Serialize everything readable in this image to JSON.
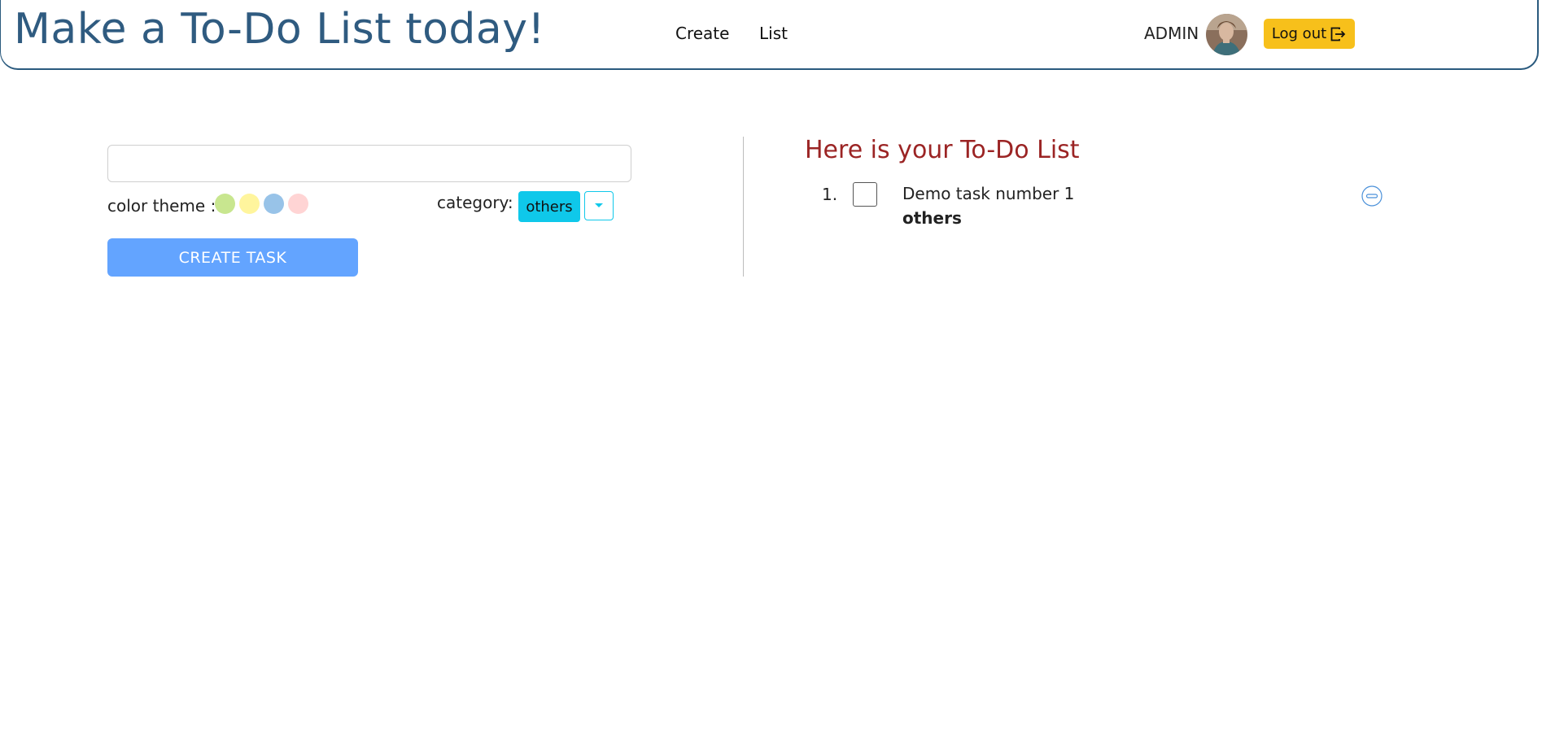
{
  "header": {
    "app_title": "Make a To-Do List today!",
    "nav": [
      {
        "label": "Create"
      },
      {
        "label": "List"
      }
    ],
    "user_name": "ADMIN",
    "logout_label": "Log out"
  },
  "create_form": {
    "task_input_value": "",
    "task_input_placeholder": "",
    "color_theme_label": "color theme :",
    "color_options": [
      "#c8e68f",
      "#fff59d",
      "#98c3e8",
      "#ffd4d4"
    ],
    "category_label": "category:",
    "category_selected": "others",
    "create_button_label": "CREATE TASK"
  },
  "todo_list": {
    "title": "Here is your To-Do List",
    "items": [
      {
        "number": "1.",
        "text": "Demo task number 1",
        "category": "others",
        "done": false
      }
    ]
  },
  "colors": {
    "brand_blue": "#2f5b80",
    "logout_yellow": "#f7c01b",
    "category_cyan": "#0fc8ea",
    "create_button_blue": "#63a4ff",
    "list_title_red": "#9b2424",
    "remove_icon_blue": "#4a90d9"
  },
  "icons": {
    "logout": "logout-icon",
    "dropdown": "caret-down-icon",
    "remove": "minus-circle-icon"
  }
}
